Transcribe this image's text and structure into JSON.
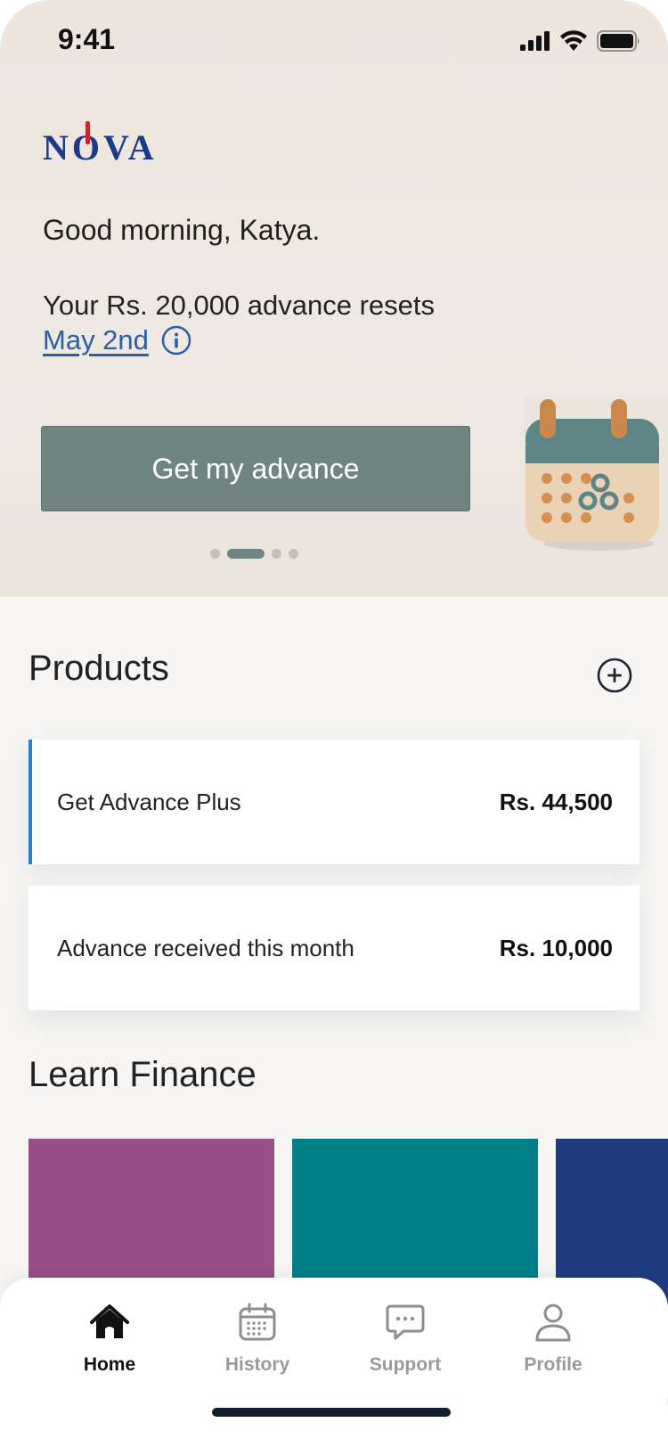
{
  "status_bar": {
    "time": "9:41",
    "icons": [
      "signal-icon",
      "wifi-icon",
      "battery-icon"
    ]
  },
  "brand": {
    "logo_text_n": "N",
    "logo_text_o": "O",
    "logo_text_va": "VA",
    "logo_color": "#1c3a8c",
    "logo_accent_color": "#d3222f"
  },
  "hero": {
    "greeting": "Good morning, Katya.",
    "reset_text": "Your Rs. 20,000 advance resets",
    "reset_date": "May 2nd",
    "cta_label": "Get my advance",
    "cta_color": "#6f8582",
    "pager": {
      "total": 4,
      "active": 1
    }
  },
  "products": {
    "title": "Products",
    "items": [
      {
        "label": "Get Advance Plus",
        "value": "Rs. 44,500",
        "highlight_color": "#1f7fd4"
      },
      {
        "label": "Advance received this month",
        "value": "Rs. 10,000"
      }
    ]
  },
  "learn": {
    "title": "Learn Finance",
    "cards": [
      {
        "color": "#974f88"
      },
      {
        "color": "#007f87"
      },
      {
        "color": "#1e3b80"
      }
    ]
  },
  "tab_bar": {
    "active": "home",
    "tabs": [
      {
        "id": "home",
        "label": "Home",
        "icon": "home-icon"
      },
      {
        "id": "history",
        "label": "History",
        "icon": "calendar-icon"
      },
      {
        "id": "support",
        "label": "Support",
        "icon": "chat-bubble-icon"
      },
      {
        "id": "profile",
        "label": "Profile",
        "icon": "user-icon"
      }
    ]
  }
}
